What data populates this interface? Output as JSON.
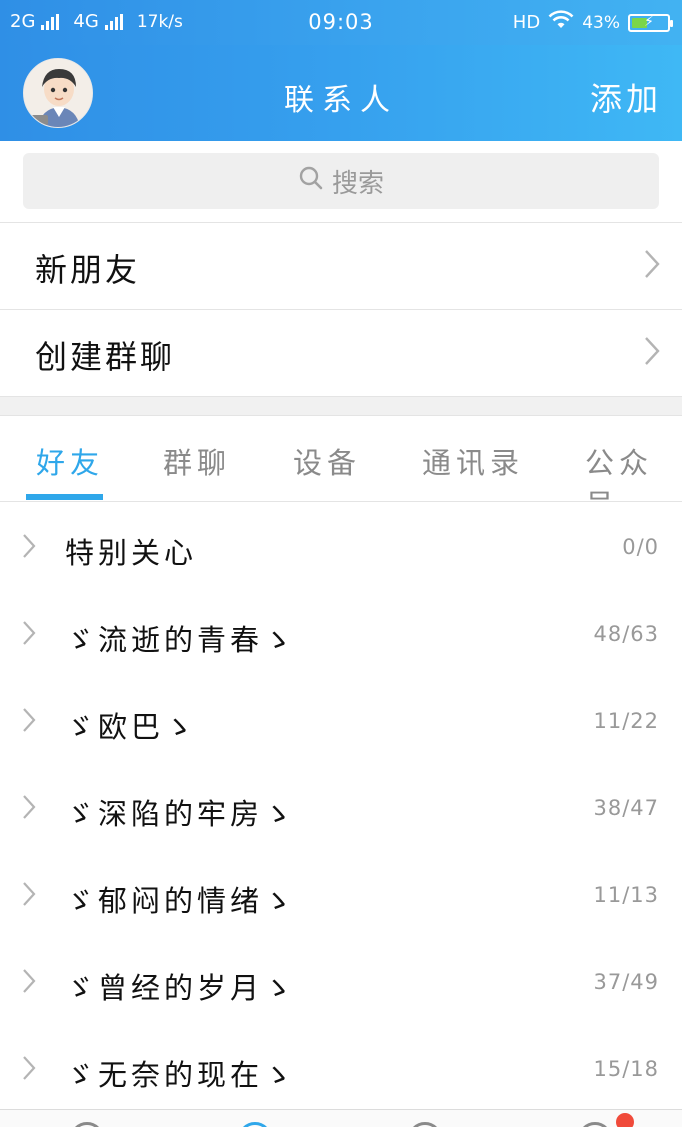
{
  "status_bar": {
    "network1": "2G",
    "network2": "4G",
    "speed": "17k/s",
    "time": "09:03",
    "hd": "HD",
    "battery": "43%",
    "battery_level": 0.43
  },
  "header": {
    "title": "联系人",
    "action_label": "添加"
  },
  "search": {
    "placeholder": "搜索"
  },
  "entries": [
    {
      "label": "新朋友"
    },
    {
      "label": "创建群聊"
    }
  ],
  "tabs": [
    {
      "label": "好友",
      "active": true
    },
    {
      "label": "群聊"
    },
    {
      "label": "设备"
    },
    {
      "label": "通讯录"
    },
    {
      "label": "公众号"
    }
  ],
  "groups": [
    {
      "name": "特别关心",
      "count": "0/0"
    },
    {
      "name": "ゞ流逝的青春ゝ",
      "count": "48/63"
    },
    {
      "name": "ゞ欧巴ゝ",
      "count": "11/22"
    },
    {
      "name": "ゞ深陷的牢房ゝ",
      "count": "38/47"
    },
    {
      "name": "ゞ郁闷的情绪ゝ",
      "count": "11/13"
    },
    {
      "name": "ゞ曾经的岁月ゝ",
      "count": "37/49"
    },
    {
      "name": "ゞ无奈的现在ゝ",
      "count": "15/18"
    }
  ],
  "colors": {
    "accent": "#2fa7ea",
    "header_start": "#2f8fe6",
    "header_end": "#3fb8f5",
    "badge": "#f04a3a"
  },
  "icons": {
    "search": "search-icon",
    "chevron": "chevron-right-icon",
    "wifi": "wifi-icon",
    "battery": "battery-icon"
  }
}
